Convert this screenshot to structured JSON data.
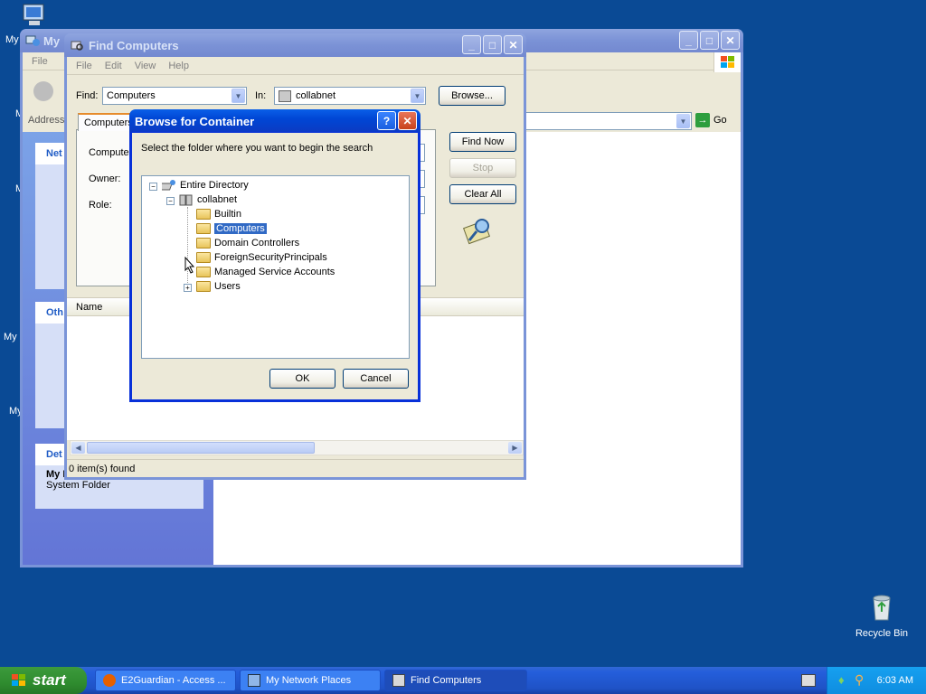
{
  "desktop": {
    "recycle_bin": "Recycle Bin",
    "partial_labels": [
      "My",
      "My",
      "My",
      "My",
      "My"
    ]
  },
  "explorer": {
    "title": "My",
    "menu": [
      "File"
    ],
    "address_label": "Address",
    "go_label": "Go",
    "panels": {
      "net_heading": "Net",
      "other_heading": "Oth",
      "details_heading": "Det",
      "details_title": "My Network Places",
      "details_sub": "System Folder"
    }
  },
  "find_window": {
    "title": "Find Computers",
    "menu": [
      "File",
      "Edit",
      "View",
      "Help"
    ],
    "find_label": "Find:",
    "find_value": "Computers",
    "in_label": "In:",
    "in_value": "collabnet",
    "browse_button": "Browse...",
    "tab_label": "Computers",
    "computer_label": "Compute",
    "owner_label": "Owner:",
    "role_label": "Role:",
    "find_now_button": "Find Now",
    "stop_button": "Stop",
    "clear_all_button": "Clear All",
    "results_column": "Name",
    "status": "0 item(s) found"
  },
  "browse_dialog": {
    "title": "Browse for Container",
    "help_glyph": "?",
    "instructions": "Select the folder where you want to begin the search",
    "tree": {
      "root": "Entire Directory",
      "domain": "collabnet",
      "items": [
        "Builtin",
        "Computers",
        "Domain Controllers",
        "ForeignSecurityPrincipals",
        "Managed Service Accounts",
        "Users"
      ],
      "selected": "Computers"
    },
    "ok_button": "OK",
    "cancel_button": "Cancel"
  },
  "taskbar": {
    "start_label": "start",
    "tasks": [
      "E2Guardian - Access ...",
      "My Network Places",
      "Find Computers"
    ],
    "clock": "6:03 AM"
  },
  "colors": {
    "desktop": "#0a4a95",
    "title_active": "#0a5fe8",
    "selection": "#316ac5"
  }
}
